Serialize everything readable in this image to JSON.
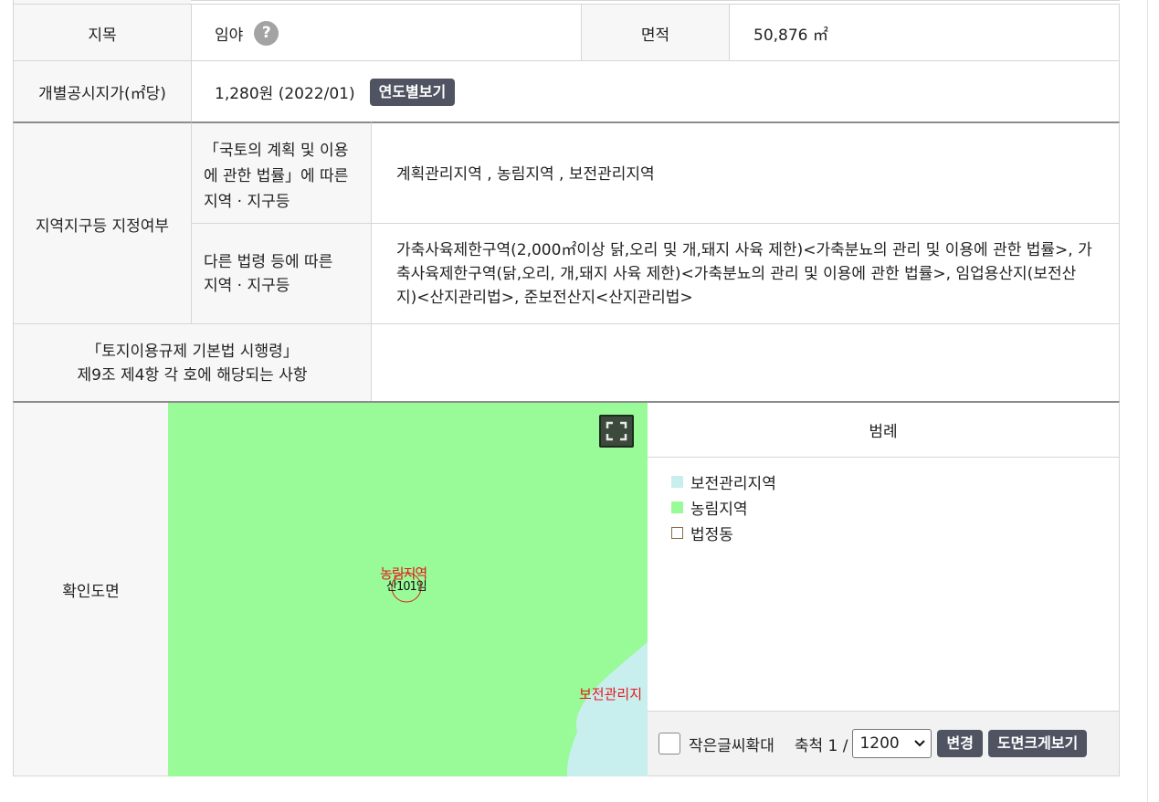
{
  "row1": {
    "jimok_label": "지목",
    "jimok_value": "임야",
    "help_icon": "?",
    "area_label": "면적",
    "area_value": "50,876 ㎡"
  },
  "row2": {
    "label": "개별공시지가(㎡당)",
    "value": "1,280원 (2022/01)",
    "button": "연도별보기"
  },
  "zone": {
    "label": "지역지구등 지정여부",
    "sub1_label": "「국토의 계획 및 이용\n에 관한 법률」에 따른\n지역 · 지구등",
    "sub1_value": "계획관리지역 , 농림지역 , 보전관리지역",
    "sub2_label": "다른 법령 등에 따른\n지역 · 지구등",
    "sub2_value": "가축사육제한구역(2,000㎡이상 닭,오리 및 개,돼지 사육 제한)<가축분뇨의 관리 및 이용에 관한 법률>, 가축사육제한구역(닭,오리, 개,돼지 사육 제한)<가축분뇨의 관리 및 이용에 관한 법률>, 임업용산지(보전산지)<산지관리법>, 준보전산지<산지관리법>"
  },
  "regulation": {
    "label": "「토지이용규제 기본법 시행령」\n제9조 제4항 각 호에 해당되는 사항",
    "value": ""
  },
  "map": {
    "label": "확인도면",
    "fullscreen_icon": "fullscreen-icon",
    "zone_label_farm": "농림지역",
    "parcel_label": "산101임",
    "zone_label_conserve": "보전관리지",
    "colors": {
      "farm": "#98fb98",
      "conserve": "#c8eeee",
      "label_red": "#e8161b"
    }
  },
  "legend": {
    "title": "범례",
    "items": [
      {
        "label": "보전관리지역",
        "color": "#c8eeee"
      },
      {
        "label": "농림지역",
        "color": "#98fb98"
      },
      {
        "label": "법정동",
        "color": "#ffffff"
      }
    ]
  },
  "controls": {
    "enlarge_text_label": "작은글씨확대",
    "scale_label": "축척 1 /",
    "scale_value": "1200",
    "scale_options": [
      "1200"
    ],
    "change_button": "변경",
    "big_map_button": "도면크게보기"
  }
}
